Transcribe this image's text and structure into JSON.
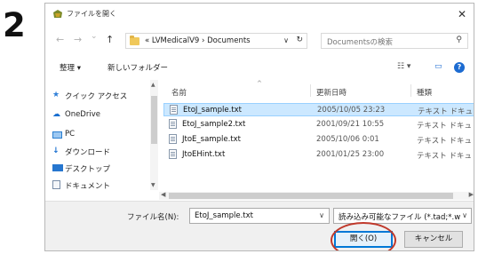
{
  "step_number": "2",
  "window": {
    "title": "ファイルを開く",
    "close_glyph": "✕"
  },
  "address": {
    "back_glyph": "←",
    "forward_glyph": "→",
    "recent_glyph": "⌄",
    "up_glyph": "↑",
    "overflow": "«",
    "crumb_1": "LVMedicalV9",
    "crumb_sep": "›",
    "crumb_2": "Documents",
    "dropdown_glyph": "∨",
    "refresh_glyph": "↻",
    "search_placeholder": "Documentsの検索",
    "search_glyph": "⚲"
  },
  "toolbar": {
    "organize": "整理 ▾",
    "new_folder": "新しいフォルダー",
    "view_glyph": "☷ ▾",
    "pane_glyph": "▭",
    "help_glyph": "?"
  },
  "nav": {
    "items": [
      {
        "label": "クイック アクセス",
        "icon": "star-icon"
      },
      {
        "label": "OneDrive",
        "icon": "cloud-icon"
      },
      {
        "label": "PC",
        "icon": "pc-icon"
      },
      {
        "label": "ダウンロード",
        "icon": "download-icon"
      },
      {
        "label": "デスクトップ",
        "icon": "desktop-icon"
      },
      {
        "label": "ドキュメント",
        "icon": "document-icon"
      }
    ]
  },
  "filelist": {
    "columns": {
      "name": "名前",
      "date": "更新日時",
      "type": "種類"
    },
    "sort_glyph": "^",
    "rows": [
      {
        "name": "EtoJ_sample.txt",
        "date": "2005/10/05 23:23",
        "type": "テキスト ドキュ",
        "selected": true
      },
      {
        "name": "EtoJ_sample2.txt",
        "date": "2001/09/21 10:55",
        "type": "テキスト ドキュ",
        "selected": false
      },
      {
        "name": "JtoE_sample.txt",
        "date": "2005/10/06 0:01",
        "type": "テキスト ドキュ",
        "selected": false
      },
      {
        "name": "JtoEHint.txt",
        "date": "2001/01/25 23:00",
        "type": "テキスト ドキュ",
        "selected": false
      }
    ]
  },
  "bottom": {
    "filename_label": "ファイル名(N):",
    "filename_value": "EtoJ_sample.txt",
    "filename_dd": "∨",
    "filetype_value": "読み込み可能なファイル (*.tad;*.w",
    "filetype_dd": "∨",
    "open_button": "開く(O)",
    "cancel_button": "キャンセル"
  },
  "colors": {
    "selection_bg": "#cce8ff",
    "accent": "#0078d7",
    "highlight_ring": "#c0392b"
  }
}
